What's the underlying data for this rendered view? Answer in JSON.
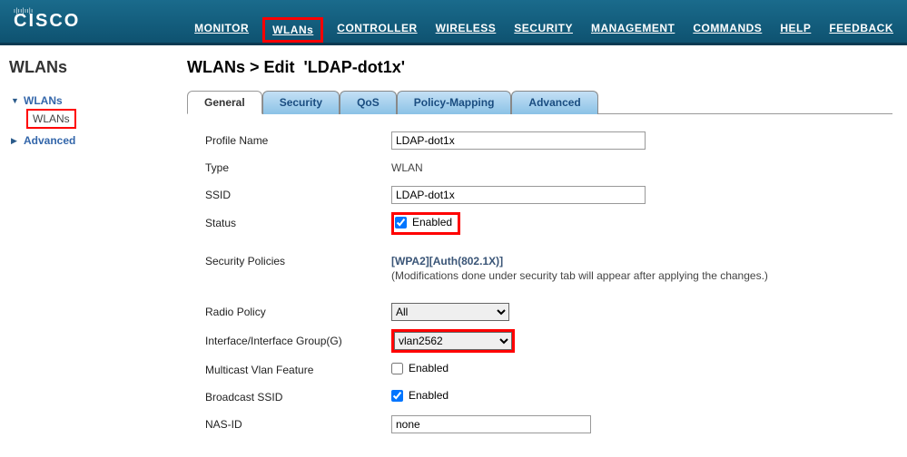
{
  "brand": "CISCO",
  "topnav": {
    "monitor": "MONITOR",
    "wlans": "WLANs",
    "controller": "CONTROLLER",
    "wireless": "WIRELESS",
    "security": "SECURITY",
    "management": "MANAGEMENT",
    "commands": "COMMANDS",
    "help": "HELP",
    "feedback": "FEEDBACK"
  },
  "sidebar": {
    "title": "WLANs",
    "items": {
      "wlans": "WLANs",
      "wlans_sub": "WLANs",
      "advanced": "Advanced"
    }
  },
  "breadcrumb": {
    "part1": "WLANs > Edit",
    "part2": "'LDAP-dot1x'"
  },
  "tabs": {
    "general": "General",
    "security": "Security",
    "qos": "QoS",
    "policy": "Policy-Mapping",
    "advanced": "Advanced"
  },
  "form": {
    "profile_name_label": "Profile Name",
    "profile_name_value": "LDAP-dot1x",
    "type_label": "Type",
    "type_value": "WLAN",
    "ssid_label": "SSID",
    "ssid_value": "LDAP-dot1x",
    "status_label": "Status",
    "status_enabled": "Enabled",
    "security_policies_label": "Security Policies",
    "security_policies_value": "[WPA2][Auth(802.1X)]",
    "security_policies_note": "(Modifications done under security tab will appear after applying the changes.)",
    "radio_policy_label": "Radio Policy",
    "radio_policy_value": "All",
    "interface_group_label": "Interface/Interface Group(G)",
    "interface_group_value": "vlan2562",
    "multicast_label": "Multicast Vlan Feature",
    "multicast_enabled": "Enabled",
    "broadcast_label": "Broadcast SSID",
    "broadcast_enabled": "Enabled",
    "nasid_label": "NAS-ID",
    "nasid_value": "none"
  }
}
